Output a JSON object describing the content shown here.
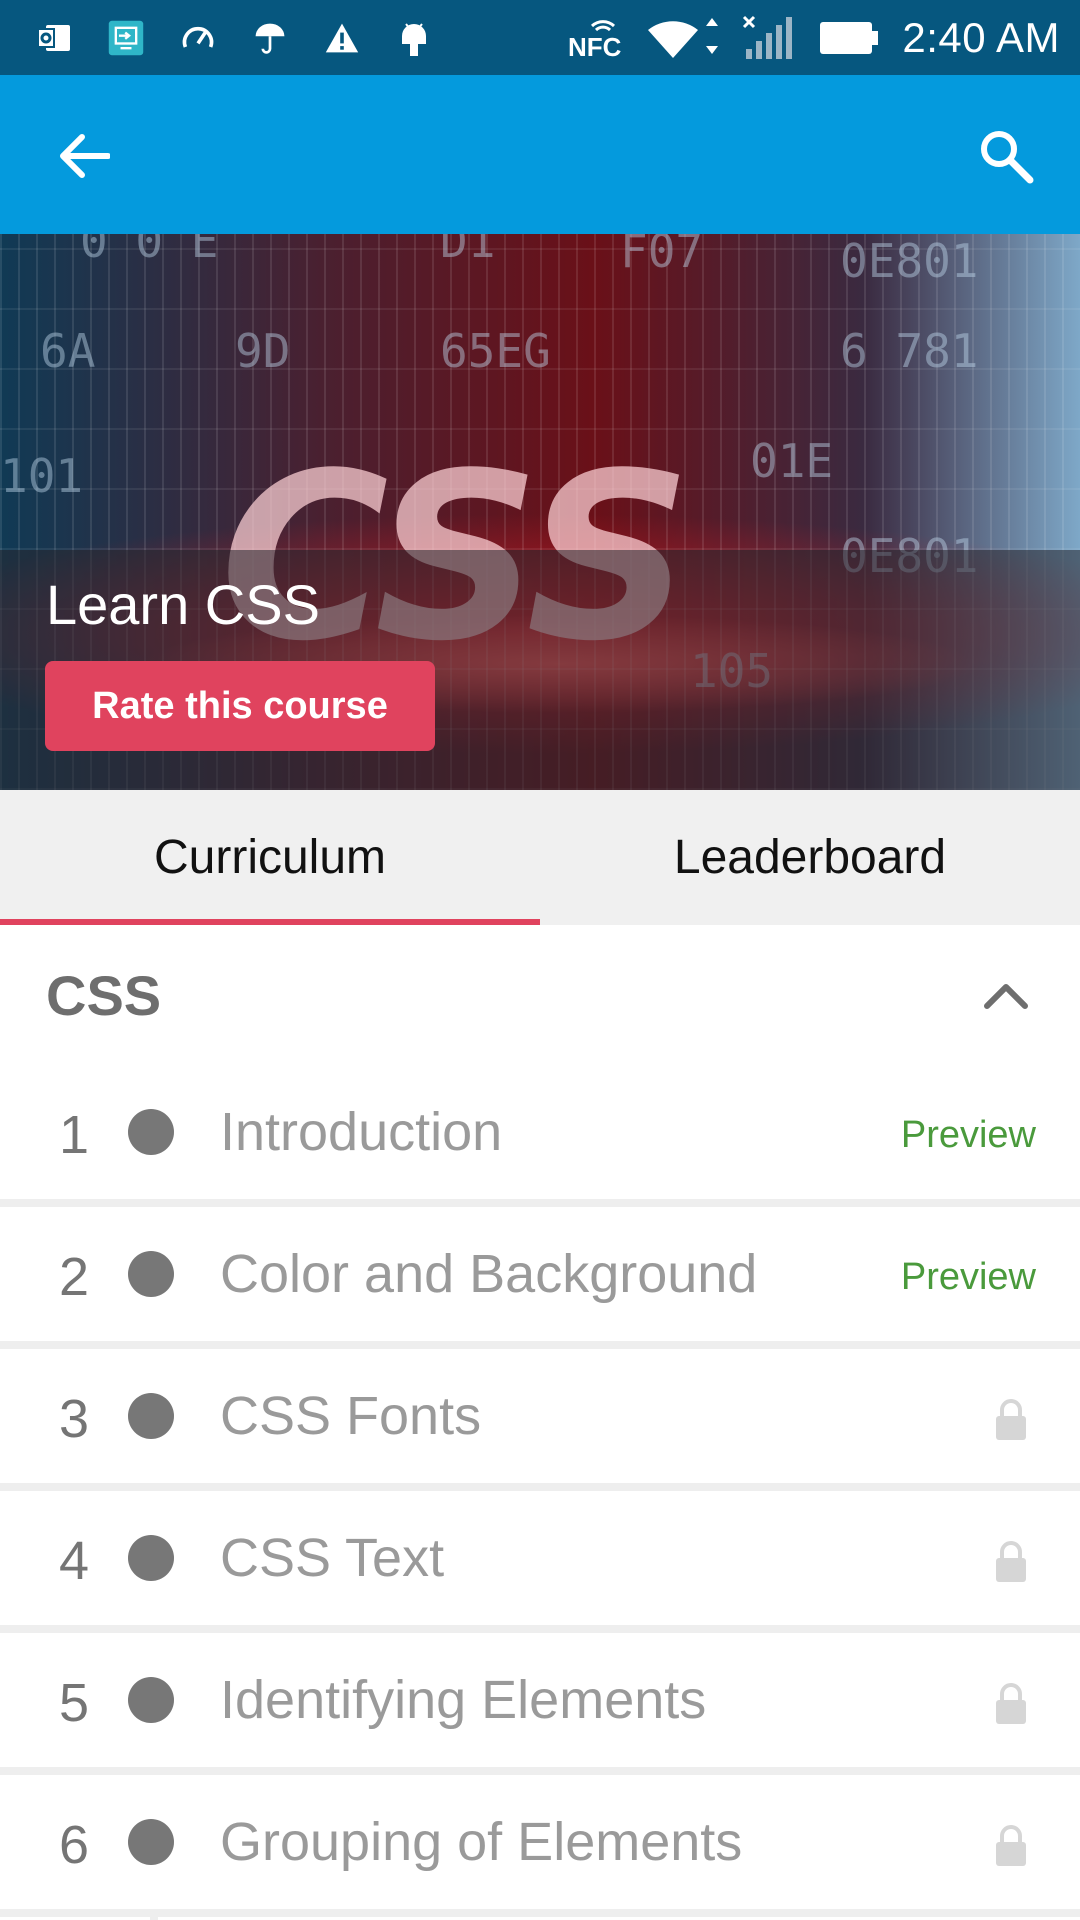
{
  "status_bar": {
    "time": "2:40 AM",
    "nfc_label": "NFC",
    "icons": [
      "outlook-icon",
      "screen-share-icon",
      "speedometer-icon",
      "umbrella-icon",
      "warning-icon",
      "android-icon",
      "nfc-icon",
      "wifi-icon",
      "signal-icon",
      "battery-icon"
    ]
  },
  "app_bar": {
    "back_icon": "arrow-back-icon",
    "search_icon": "search-icon",
    "color": "#049add"
  },
  "banner": {
    "logo_text": "CSS",
    "course_title": "Learn CSS",
    "rate_button": "Rate this course",
    "accent": "#e0435e"
  },
  "tabs": [
    {
      "label": "Curriculum",
      "active": true
    },
    {
      "label": "Leaderboard",
      "active": false
    }
  ],
  "section": {
    "title": "CSS",
    "expanded": true
  },
  "lessons": [
    {
      "number": "1",
      "title": "Introduction",
      "status": "Preview"
    },
    {
      "number": "2",
      "title": "Color and Background",
      "status": "Preview"
    },
    {
      "number": "3",
      "title": "CSS Fonts",
      "status": "locked"
    },
    {
      "number": "4",
      "title": "CSS Text",
      "status": "locked"
    },
    {
      "number": "5",
      "title": "Identifying Elements",
      "status": "locked"
    },
    {
      "number": "6",
      "title": "Grouping of Elements",
      "status": "locked"
    }
  ]
}
